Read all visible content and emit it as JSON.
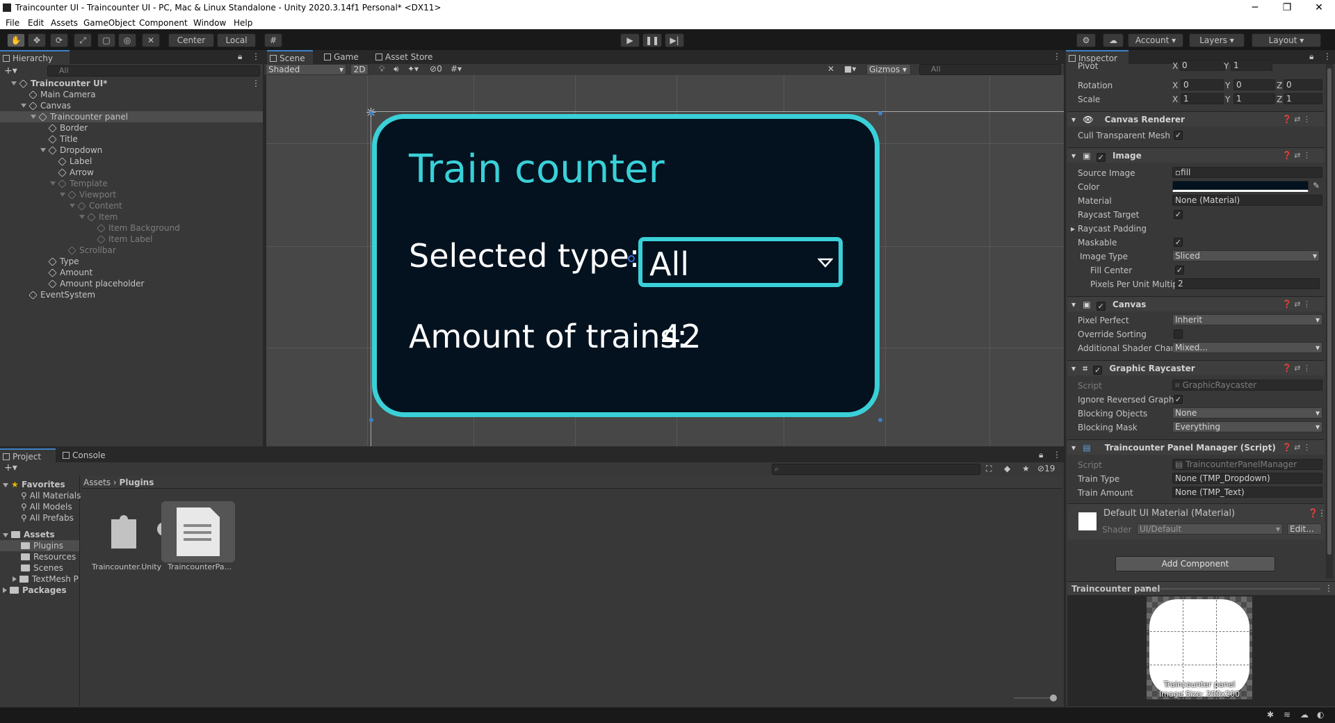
{
  "window": {
    "title": "Traincounter UI - Traincounter UI - PC, Mac & Linux Standalone - Unity 2020.3.14f1 Personal* <DX11>",
    "minimize": "─",
    "maximize": "❐",
    "close": "✕"
  },
  "menu": [
    "File",
    "Edit",
    "Assets",
    "GameObject",
    "Component",
    "Window",
    "Help"
  ],
  "toolbar": {
    "center": "Center",
    "local": "Local",
    "account": "Account",
    "layers": "Layers",
    "layout": "Layout"
  },
  "hierarchy": {
    "tab": "Hierarchy",
    "search_placeholder": "All",
    "items": [
      {
        "label": "Traincounter UI*",
        "depth": 0,
        "bold": true,
        "dim": false
      },
      {
        "label": "Main Camera",
        "depth": 1,
        "dim": false
      },
      {
        "label": "Canvas",
        "depth": 1,
        "dim": false
      },
      {
        "label": "Traincounter panel",
        "depth": 2,
        "dim": false
      },
      {
        "label": "Border",
        "depth": 3,
        "dim": false
      },
      {
        "label": "Title",
        "depth": 3,
        "dim": false
      },
      {
        "label": "Dropdown",
        "depth": 3,
        "dim": false
      },
      {
        "label": "Label",
        "depth": 4,
        "dim": false
      },
      {
        "label": "Arrow",
        "depth": 4,
        "dim": false
      },
      {
        "label": "Template",
        "depth": 4,
        "dim": true
      },
      {
        "label": "Viewport",
        "depth": 5,
        "dim": true
      },
      {
        "label": "Content",
        "depth": 6,
        "dim": true
      },
      {
        "label": "Item",
        "depth": 7,
        "dim": true
      },
      {
        "label": "Item Background",
        "depth": 8,
        "dim": true
      },
      {
        "label": "Item Label",
        "depth": 8,
        "dim": true
      },
      {
        "label": "Scrollbar",
        "depth": 5,
        "dim": true
      },
      {
        "label": "Type",
        "depth": 3,
        "dim": false
      },
      {
        "label": "Amount",
        "depth": 3,
        "dim": false
      },
      {
        "label": "Amount placeholder",
        "depth": 3,
        "dim": false
      },
      {
        "label": "EventSystem",
        "depth": 1,
        "dim": false
      }
    ]
  },
  "scene_tabs": {
    "scene": "Scene",
    "game": "Game",
    "asset_store": "Asset Store"
  },
  "scene_toolbar": {
    "shading": "Shaded",
    "mode2d": "2D",
    "hidden_count": "0",
    "gizmos": "Gizmos",
    "search_placeholder": "All"
  },
  "ui_panel": {
    "title": "Train counter",
    "selected_type_label": "Selected type:",
    "dropdown_value": "All",
    "amount_label": "Amount of trains:",
    "amount_value": "42",
    "accent": "#3ad0d8",
    "panel_bg": "#04121f"
  },
  "project": {
    "tab_project": "Project",
    "tab_console": "Console",
    "hidden_count": "19",
    "favorites": "Favorites",
    "favorites_items": [
      "All Materials",
      "All Models",
      "All Prefabs"
    ],
    "assets": "Assets",
    "assets_items": [
      "Plugins",
      "Resources",
      "Scenes",
      "TextMesh P"
    ],
    "packages": "Packages",
    "breadcrumb_root": "Assets",
    "breadcrumb_current": "Plugins",
    "files": [
      {
        "name": "Traincounter.Unity"
      },
      {
        "name": "TraincounterPa..."
      }
    ]
  },
  "inspector": {
    "tab": "Inspector",
    "pivot": {
      "label": "Pivot",
      "x": "0",
      "y": "1"
    },
    "rotation": {
      "label": "Rotation",
      "x": "0",
      "y": "0",
      "z": "0"
    },
    "scale": {
      "label": "Scale",
      "x": "1",
      "y": "1",
      "z": "1"
    },
    "canvas_renderer": {
      "title": "Canvas Renderer",
      "cull_label": "Cull Transparent Mesh"
    },
    "image": {
      "title": "Image",
      "source_image_label": "Source Image",
      "source_image": "fill",
      "color_label": "Color",
      "material_label": "Material",
      "material": "None (Material)",
      "raycast_target": "Raycast Target",
      "raycast_padding": "Raycast Padding",
      "maskable": "Maskable",
      "image_type_label": "Image Type",
      "image_type": "Sliced",
      "fill_center": "Fill Center",
      "ppu_label": "Pixels Per Unit Multip",
      "ppu": "2"
    },
    "canvas": {
      "title": "Canvas",
      "pixel_perfect_label": "Pixel Perfect",
      "pixel_perfect": "Inherit",
      "override_sorting": "Override Sorting",
      "shader_channels_label": "Additional Shader Chan",
      "shader_channels": "Mixed..."
    },
    "graphic_raycaster": {
      "title": "Graphic Raycaster",
      "script_label": "Script",
      "script": "GraphicRaycaster",
      "ignore_reversed": "Ignore Reversed Graphic",
      "blocking_objects_label": "Blocking Objects",
      "blocking_objects": "None",
      "blocking_mask_label": "Blocking Mask",
      "blocking_mask": "Everything"
    },
    "manager": {
      "title": "Traincounter Panel Manager (Script)",
      "script_label": "Script",
      "script": "TraincounterPanelManager",
      "train_type_label": "Train Type",
      "train_type": "None (TMP_Dropdown)",
      "train_amount_label": "Train Amount",
      "train_amount": "None (TMP_Text)"
    },
    "material": {
      "title": "Default UI Material (Material)",
      "shader_label": "Shader",
      "shader": "UI/Default",
      "edit": "Edit..."
    },
    "add_component": "Add Component",
    "preview": {
      "title": "Traincounter panel",
      "caption1": "Traincounter panel",
      "caption2": "Image Size: 200x200"
    }
  }
}
